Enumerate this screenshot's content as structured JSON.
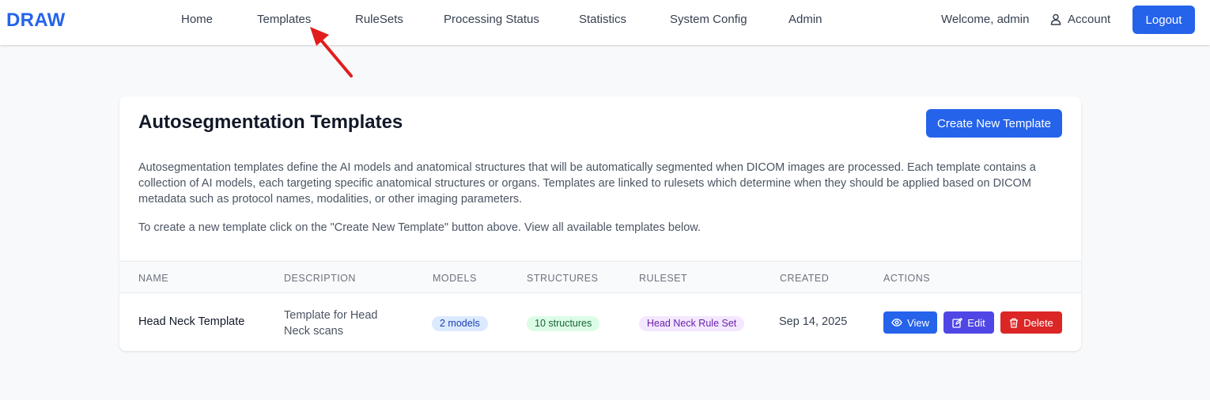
{
  "nav": {
    "brand": "DRAW",
    "links": [
      "Home",
      "Templates",
      "RuleSets",
      "Processing Status",
      "Statistics",
      "System Config",
      "Admin"
    ],
    "welcome": "Welcome, admin",
    "account": "Account",
    "logout": "Logout"
  },
  "page": {
    "title": "Autosegmentation Templates",
    "create_button": "Create New Template",
    "description": "Autosegmentation templates define the AI models and anatomical structures that will be automatically segmented when DICOM images are processed. Each template contains a collection of AI models, each targeting specific anatomical structures or organs. Templates are linked to rulesets which determine when they should be applied based on DICOM metadata such as protocol names, modalities, or other imaging parameters.",
    "instruction": "To create a new template click on the \"Create New Template\" button above. View all available templates below."
  },
  "table": {
    "headers": [
      "Name",
      "Description",
      "Models",
      "Structures",
      "Ruleset",
      "Created",
      "Actions"
    ],
    "rows": [
      {
        "name": "Head Neck Template",
        "description": "Template for Head Neck scans",
        "models": "2 models",
        "structures": "10 structures",
        "ruleset": "Head Neck Rule Set",
        "created": "Sep 14, 2025",
        "actions": {
          "view": "View",
          "edit": "Edit",
          "delete": "Delete"
        }
      }
    ]
  },
  "colors": {
    "brand": "#2563eb",
    "primary": "#2563eb",
    "edit": "#4f46e5",
    "danger": "#dc2626",
    "annotation_arrow": "#e11d1d"
  }
}
